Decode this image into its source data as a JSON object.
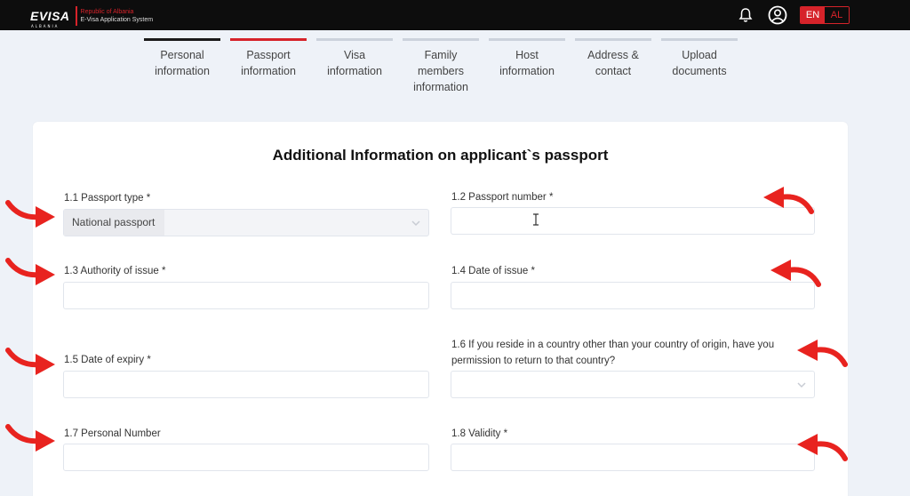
{
  "header": {
    "logo_main": "EVISA",
    "logo_sub": "ALBANIA",
    "logo_line1": "Republic of Albania",
    "logo_line2": "E-Visa Application System",
    "lang_en": "EN",
    "lang_al": "AL"
  },
  "steps": [
    {
      "label": "Personal information",
      "state": "done"
    },
    {
      "label": "Passport information",
      "state": "active"
    },
    {
      "label": "Visa information",
      "state": "pending"
    },
    {
      "label": "Family members information",
      "state": "pending"
    },
    {
      "label": "Host information",
      "state": "pending"
    },
    {
      "label": "Address & contact",
      "state": "pending"
    },
    {
      "label": "Upload documents",
      "state": "pending"
    }
  ],
  "form": {
    "title": "Additional Information on applicant`s passport",
    "f1_label": "1.1 Passport type *",
    "f1_value": "National passport",
    "f2_label": "1.2 Passport number *",
    "f3_label": "1.3 Authority of issue *",
    "f4_label": "1.4 Date of issue *",
    "f5_label": "1.5 Date of expiry *",
    "f6_label": "1.6 If you reside in a country other than your country of origin, have you permission to return to that country?",
    "f7_label": "1.7 Personal Number",
    "f8_label": "1.8 Validity *"
  },
  "colors": {
    "accent": "#d6232a",
    "topbar": "#0d0d0d",
    "background": "#eef2f8",
    "annotation_arrow": "#e8231f"
  },
  "icons": [
    "bell-icon",
    "user-circle-icon",
    "chevron-down-icon",
    "text-cursor-icon",
    "red-arrow-annotation-icon"
  ]
}
